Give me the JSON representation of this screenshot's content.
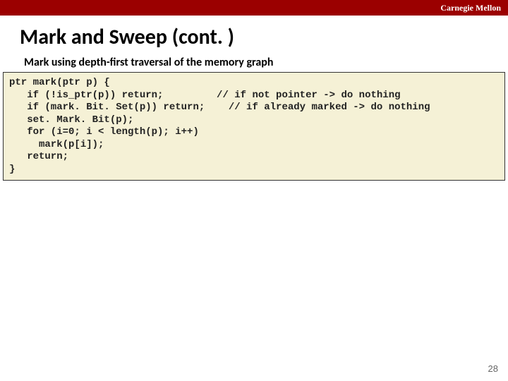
{
  "topbar": {
    "brand": "Carnegie Mellon"
  },
  "title": "Mark and Sweep (cont. )",
  "subtitle": "Mark using depth-first traversal of the memory graph",
  "code": "ptr mark(ptr p) {\n   if (!is_ptr(p)) return;         // if not pointer -> do nothing\n   if (mark. Bit. Set(p)) return;    // if already marked -> do nothing\n   set. Mark. Bit(p);\n   for (i=0; i < length(p); i++)\n     mark(p[i]);\n   return;\n}",
  "page_number": "28"
}
